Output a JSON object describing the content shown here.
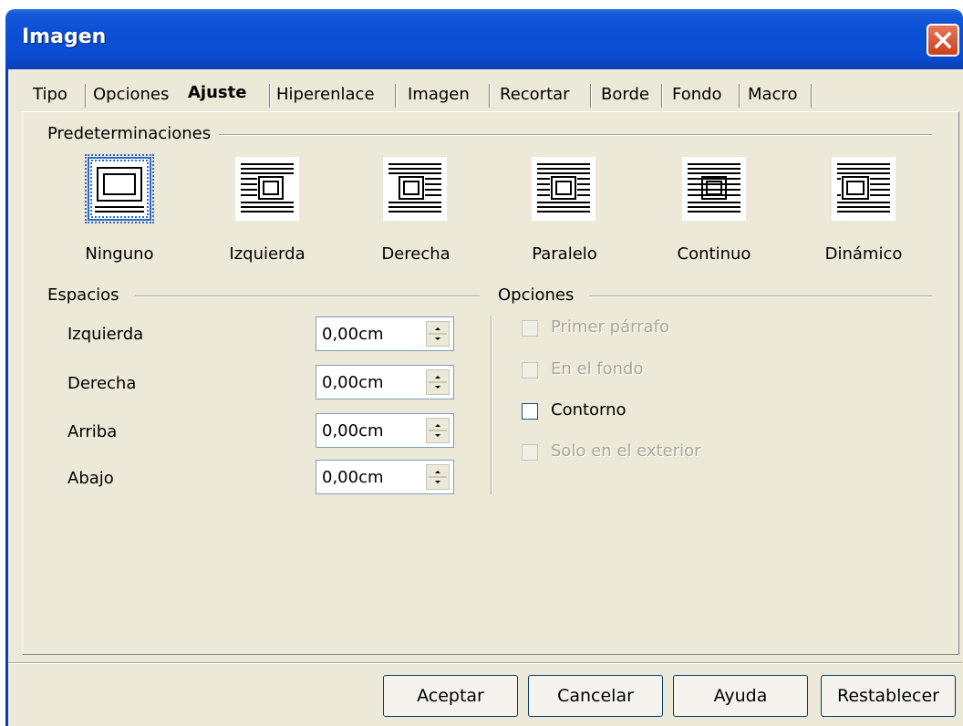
{
  "window": {
    "title": "Imagen"
  },
  "tabs": [
    {
      "label": "Tipo"
    },
    {
      "label": "Opciones"
    },
    {
      "label": "Ajuste",
      "active": true
    },
    {
      "label": "Hiperenlace"
    },
    {
      "label": "Imagen"
    },
    {
      "label": "Recortar"
    },
    {
      "label": "Borde"
    },
    {
      "label": "Fondo"
    },
    {
      "label": "Macro"
    }
  ],
  "presets": {
    "group_label": "Predeterminaciones",
    "items": [
      {
        "label": "Ninguno",
        "selected": true,
        "icon": "wrap-none-icon"
      },
      {
        "label": "Izquierda",
        "icon": "wrap-left-icon"
      },
      {
        "label": "Derecha",
        "icon": "wrap-right-icon"
      },
      {
        "label": "Paralelo",
        "icon": "wrap-parallel-icon"
      },
      {
        "label": "Continuo",
        "icon": "wrap-through-icon"
      },
      {
        "label": "Dinámico",
        "icon": "wrap-optimal-icon"
      }
    ]
  },
  "spacing": {
    "group_label": "Espacios",
    "fields": [
      {
        "label": "Izquierda",
        "value": "0,00cm"
      },
      {
        "label": "Derecha",
        "value": "0,00cm"
      },
      {
        "label": "Arriba",
        "value": "0,00cm"
      },
      {
        "label": "Abajo",
        "value": "0,00cm"
      }
    ]
  },
  "options": {
    "group_label": "Opciones",
    "items": [
      {
        "label": "Primer párrafo",
        "checked": false,
        "enabled": false
      },
      {
        "label": "En el fondo",
        "checked": false,
        "enabled": false
      },
      {
        "label": "Contorno",
        "checked": false,
        "enabled": true
      },
      {
        "label": "Solo en el exterior",
        "checked": false,
        "enabled": false
      }
    ]
  },
  "buttons": {
    "ok": "Aceptar",
    "cancel": "Cancelar",
    "help": "Ayuda",
    "reset": "Restablecer"
  },
  "colors": {
    "titlebar": "#0a4ccf",
    "dialog_bg": "#ece9d8",
    "close": "#d9582f"
  }
}
